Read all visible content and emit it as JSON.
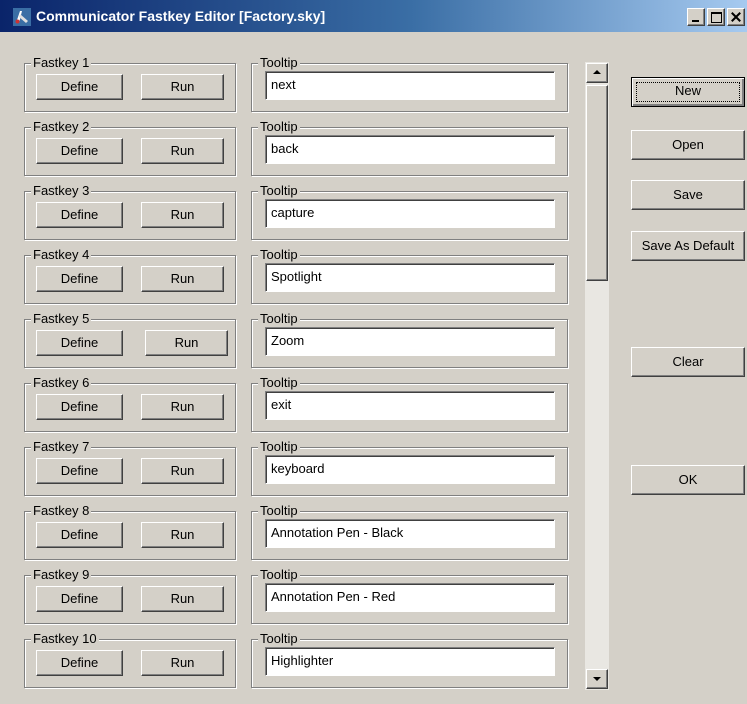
{
  "window": {
    "title": "Communicator Fastkey Editor [Factory.sky]",
    "icon": "communicator-app-icon"
  },
  "fastkeys": [
    {
      "label": "Fastkey 1",
      "define": "Define",
      "run": "Run",
      "tooltip_label": "Tooltip",
      "tooltip": "next"
    },
    {
      "label": "Fastkey 2",
      "define": "Define",
      "run": "Run",
      "tooltip_label": "Tooltip",
      "tooltip": "back"
    },
    {
      "label": "Fastkey 3",
      "define": "Define",
      "run": "Run",
      "tooltip_label": "Tooltip",
      "tooltip": "capture"
    },
    {
      "label": "Fastkey 4",
      "define": "Define",
      "run": "Run",
      "tooltip_label": "Tooltip",
      "tooltip": "Spotlight"
    },
    {
      "label": "Fastkey 5",
      "define": "Define",
      "run": "Run",
      "tooltip_label": "Tooltip",
      "tooltip": "Zoom"
    },
    {
      "label": "Fastkey 6",
      "define": "Define",
      "run": "Run",
      "tooltip_label": "Tooltip",
      "tooltip": "exit"
    },
    {
      "label": "Fastkey 7",
      "define": "Define",
      "run": "Run",
      "tooltip_label": "Tooltip",
      "tooltip": "keyboard"
    },
    {
      "label": "Fastkey 8",
      "define": "Define",
      "run": "Run",
      "tooltip_label": "Tooltip",
      "tooltip": "Annotation Pen - Black"
    },
    {
      "label": "Fastkey 9",
      "define": "Define",
      "run": "Run",
      "tooltip_label": "Tooltip",
      "tooltip": "Annotation Pen - Red"
    },
    {
      "label": "Fastkey 10",
      "define": "Define",
      "run": "Run",
      "tooltip_label": "Tooltip",
      "tooltip": "Highlighter"
    }
  ],
  "actions": {
    "new": "New",
    "open": "Open",
    "save": "Save",
    "save_as_default": "Save As Default",
    "clear": "Clear",
    "ok": "OK"
  },
  "colors": {
    "titlebar_start": "#0a246a",
    "titlebar_end": "#a6caf0",
    "face": "#d4d0c8"
  }
}
